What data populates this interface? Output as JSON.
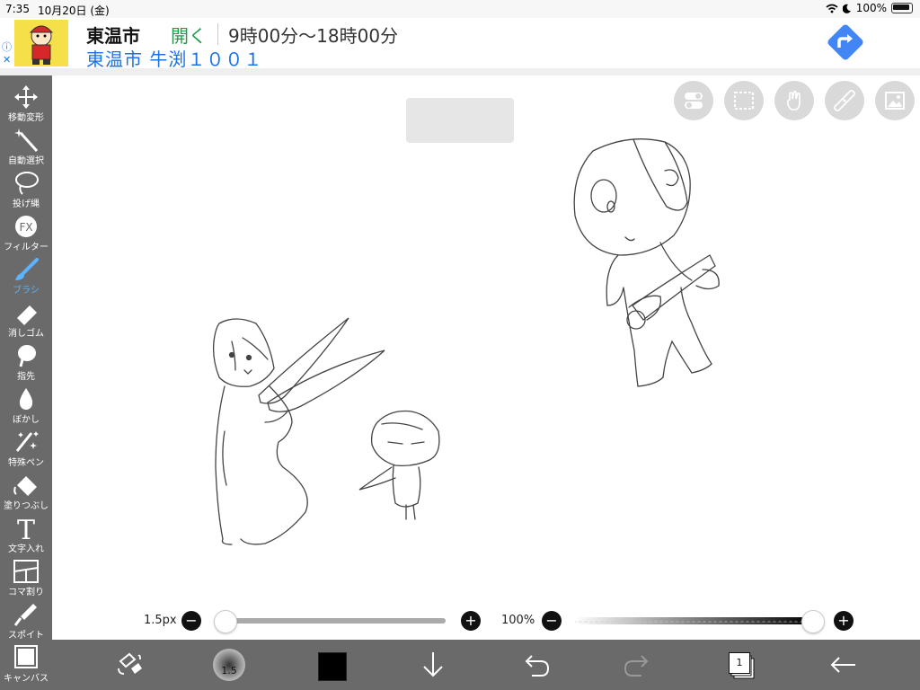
{
  "status_bar": {
    "time": "7:35",
    "date": "10月20日 (金)",
    "battery": "100%"
  },
  "ad": {
    "info": "ⓘ",
    "close": "✕",
    "title": "東温市",
    "open_label": "開く",
    "hours": "9時00分～18時00分",
    "address": "東温市 牛渕１００１",
    "accent_color": "#1a73e8"
  },
  "tools": [
    {
      "label": "移動変形",
      "icon": "move-icon"
    },
    {
      "label": "自動選択",
      "icon": "magic-wand-icon"
    },
    {
      "label": "投げ縄",
      "icon": "lasso-icon"
    },
    {
      "label": "フィルター",
      "icon": "fx-icon",
      "glyph": "FX"
    },
    {
      "label": "ブラシ",
      "icon": "brush-icon",
      "active": true
    },
    {
      "label": "消しゴム",
      "icon": "eraser-icon"
    },
    {
      "label": "指先",
      "icon": "finger-icon"
    },
    {
      "label": "ぼかし",
      "icon": "blur-drop-icon"
    },
    {
      "label": "特殊ペン",
      "icon": "special-pen-icon"
    },
    {
      "label": "塗りつぶし",
      "icon": "fill-bucket-icon"
    },
    {
      "label": "文字入れ",
      "icon": "text-icon",
      "glyph": "T"
    },
    {
      "label": "コマ割り",
      "icon": "frame-divide-icon"
    },
    {
      "label": "スポイト",
      "icon": "eyedropper-icon"
    },
    {
      "label": "キャンバス",
      "icon": "canvas-icon"
    }
  ],
  "brush_size": {
    "label": "1.5px",
    "value_fraction": 0.0,
    "minus": "−",
    "plus": "+"
  },
  "opacity": {
    "label": "100%",
    "value_fraction": 1.0,
    "minus": "−",
    "plus": "+"
  },
  "bottom_bar": {
    "brush_value": "1.5",
    "current_color": "#000000",
    "layer_count": "1"
  }
}
